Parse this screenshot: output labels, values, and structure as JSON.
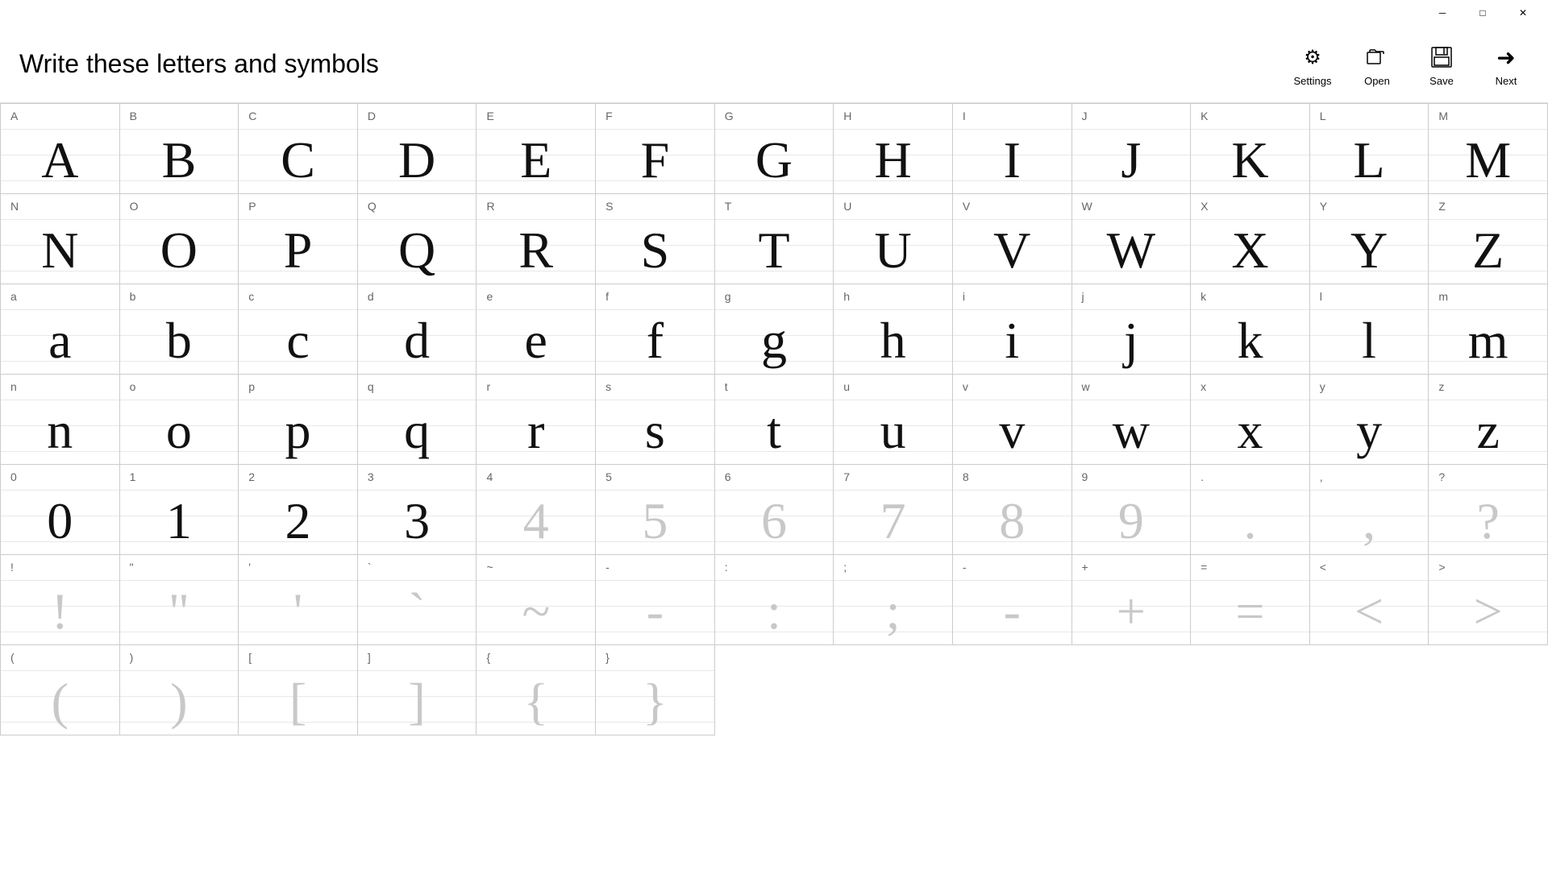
{
  "titlebar": {
    "minimize": "─",
    "maximize": "□",
    "close": "✕"
  },
  "header": {
    "title": "Write these letters and symbols",
    "toolbar": {
      "settings_label": "Settings",
      "open_label": "Open",
      "save_label": "Save",
      "next_label": "Next"
    }
  },
  "cells": [
    {
      "label": "A",
      "char": "A",
      "faded": false
    },
    {
      "label": "B",
      "char": "B",
      "faded": false
    },
    {
      "label": "C",
      "char": "C",
      "faded": false
    },
    {
      "label": "D",
      "char": "D",
      "faded": false
    },
    {
      "label": "E",
      "char": "E",
      "faded": false
    },
    {
      "label": "F",
      "char": "F",
      "faded": false
    },
    {
      "label": "G",
      "char": "G",
      "faded": false
    },
    {
      "label": "H",
      "char": "H",
      "faded": false
    },
    {
      "label": "I",
      "char": "I",
      "faded": false
    },
    {
      "label": "J",
      "char": "J",
      "faded": false
    },
    {
      "label": "K",
      "char": "K",
      "faded": false
    },
    {
      "label": "L",
      "char": "L",
      "faded": false
    },
    {
      "label": "M",
      "char": "M",
      "faded": false
    },
    {
      "label": "N",
      "char": "N",
      "faded": false
    },
    {
      "label": "O",
      "char": "O",
      "faded": false
    },
    {
      "label": "P",
      "char": "P",
      "faded": false
    },
    {
      "label": "Q",
      "char": "Q",
      "faded": false
    },
    {
      "label": "R",
      "char": "R",
      "faded": false
    },
    {
      "label": "S",
      "char": "S",
      "faded": false
    },
    {
      "label": "T",
      "char": "T",
      "faded": false
    },
    {
      "label": "U",
      "char": "U",
      "faded": false
    },
    {
      "label": "V",
      "char": "V",
      "faded": false
    },
    {
      "label": "W",
      "char": "W",
      "faded": false
    },
    {
      "label": "X",
      "char": "X",
      "faded": false
    },
    {
      "label": "Y",
      "char": "Y",
      "faded": false
    },
    {
      "label": "Z",
      "char": "Z",
      "faded": false
    },
    {
      "label": "a",
      "char": "a",
      "faded": false
    },
    {
      "label": "b",
      "char": "b",
      "faded": false
    },
    {
      "label": "c",
      "char": "c",
      "faded": false
    },
    {
      "label": "d",
      "char": "d",
      "faded": false
    },
    {
      "label": "e",
      "char": "e",
      "faded": false
    },
    {
      "label": "f",
      "char": "f",
      "faded": false
    },
    {
      "label": "g",
      "char": "g",
      "faded": false
    },
    {
      "label": "h",
      "char": "h",
      "faded": false
    },
    {
      "label": "i",
      "char": "i",
      "faded": false
    },
    {
      "label": "j",
      "char": "j",
      "faded": false
    },
    {
      "label": "k",
      "char": "k",
      "faded": false
    },
    {
      "label": "l",
      "char": "l",
      "faded": false
    },
    {
      "label": "m",
      "char": "m",
      "faded": false
    },
    {
      "label": "n",
      "char": "n",
      "faded": false
    },
    {
      "label": "o",
      "char": "o",
      "faded": false
    },
    {
      "label": "p",
      "char": "p",
      "faded": false
    },
    {
      "label": "q",
      "char": "q",
      "faded": false
    },
    {
      "label": "r",
      "char": "r",
      "faded": false
    },
    {
      "label": "s",
      "char": "s",
      "faded": false
    },
    {
      "label": "t",
      "char": "t",
      "faded": false
    },
    {
      "label": "u",
      "char": "u",
      "faded": false
    },
    {
      "label": "v",
      "char": "v",
      "faded": false
    },
    {
      "label": "w",
      "char": "w",
      "faded": false
    },
    {
      "label": "x",
      "char": "x",
      "faded": false
    },
    {
      "label": "y",
      "char": "y",
      "faded": false
    },
    {
      "label": "z",
      "char": "z",
      "faded": false
    },
    {
      "label": "0",
      "char": "0",
      "faded": false
    },
    {
      "label": "1",
      "char": "1",
      "faded": false
    },
    {
      "label": "2",
      "char": "2",
      "faded": false
    },
    {
      "label": "3",
      "char": "3",
      "faded": false
    },
    {
      "label": "4",
      "char": "4",
      "faded": true
    },
    {
      "label": "5",
      "char": "5",
      "faded": true
    },
    {
      "label": "6",
      "char": "6",
      "faded": true
    },
    {
      "label": "7",
      "char": "7",
      "faded": true
    },
    {
      "label": "8",
      "char": "8",
      "faded": true
    },
    {
      "label": "9",
      "char": "9",
      "faded": true
    },
    {
      "label": ".",
      "char": ".",
      "faded": true
    },
    {
      "label": ",",
      "char": ",",
      "faded": true
    },
    {
      "label": "?",
      "char": "?",
      "faded": true
    },
    {
      "label": "!",
      "char": "!",
      "faded": true
    },
    {
      "label": "\"",
      "char": "\"",
      "faded": true
    },
    {
      "label": "'",
      "char": "'",
      "faded": true
    },
    {
      "label": "`",
      "char": "`",
      "faded": true
    },
    {
      "label": "~",
      "char": "~",
      "faded": true
    },
    {
      "label": "-",
      "char": "-",
      "faded": true
    },
    {
      "label": ":",
      "char": ":",
      "faded": true
    },
    {
      "label": ";",
      "char": ";",
      "faded": true
    },
    {
      "label": "-",
      "char": "-",
      "faded": true
    },
    {
      "label": "+",
      "char": "+",
      "faded": true
    },
    {
      "label": "=",
      "char": "=",
      "faded": true
    },
    {
      "label": "<",
      "char": "<",
      "faded": true
    },
    {
      "label": ">",
      "char": ">",
      "faded": true
    },
    {
      "label": "(",
      "char": "(",
      "faded": true
    },
    {
      "label": ")",
      "char": ")",
      "faded": true
    },
    {
      "label": "[",
      "char": "[",
      "faded": true
    },
    {
      "label": "]",
      "char": "]",
      "faded": true
    },
    {
      "label": "{",
      "char": "{",
      "faded": true
    },
    {
      "label": "}",
      "char": "}",
      "faded": true
    }
  ]
}
